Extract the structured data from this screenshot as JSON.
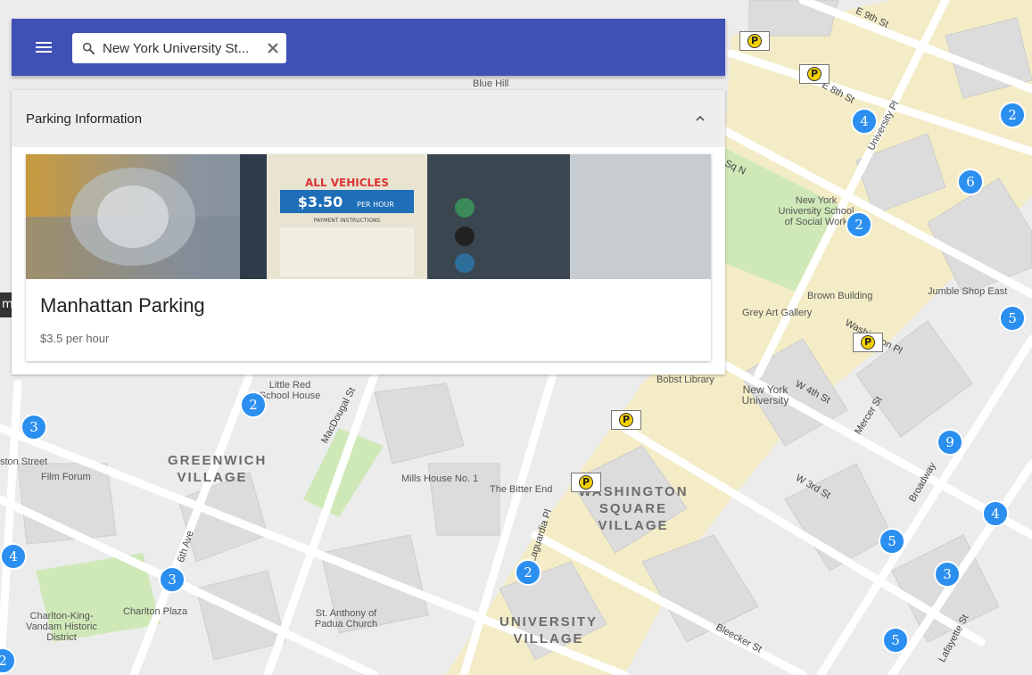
{
  "search": {
    "value": "New York University St...",
    "placeholder": "Search"
  },
  "panel": {
    "title": "Parking Information",
    "card": {
      "title": "Manhattan Parking",
      "price": "$3.5 per hour",
      "image": {
        "header": "ALL VEHICLES",
        "price": "$3.50",
        "unit": "PER HOUR",
        "note": "PAYMENT INSTRUCTIONS"
      }
    }
  },
  "tooltip": "minal",
  "map": {
    "districts": [
      "GREENWICH VILLAGE",
      "WASHINGTON SQUARE VILLAGE",
      "UNIVERSITY VILLAGE"
    ],
    "streets": [
      "E 9th St",
      "E 8th St",
      "University Pl",
      "Washington Pl",
      "W 4th St",
      "Mercer St",
      "W 3rd St",
      "Broadway",
      "Bleecker St",
      "Lafayette St",
      "Laguardia Pl",
      "6th Ave",
      "MacDougal St",
      "Sq N",
      "Mercer St"
    ],
    "places": [
      "Blue Hill",
      "New York University School of Social Work",
      "Brown Building",
      "Jumble Shop East",
      "Grey Art Gallery",
      "Bobst Library",
      "New York University",
      "Little Red School House",
      "Film Forum",
      "Mills House No. 1",
      "The Bitter End",
      "Charlton Plaza",
      "Charlton-King-Vandam Historic District",
      "St. Anthony of Padua Church",
      "ston Street"
    ],
    "clusters": [
      "4",
      "2",
      "6",
      "2",
      "5",
      "9",
      "4",
      "5",
      "3",
      "5",
      "2",
      "2",
      "3",
      "4",
      "3",
      "2"
    ],
    "parking_symbol": "P"
  },
  "colors": {
    "appbar": "#3f51b5",
    "cluster": "#2b8ff0",
    "parking": "#f4d000",
    "map_bg": "#ececec"
  }
}
